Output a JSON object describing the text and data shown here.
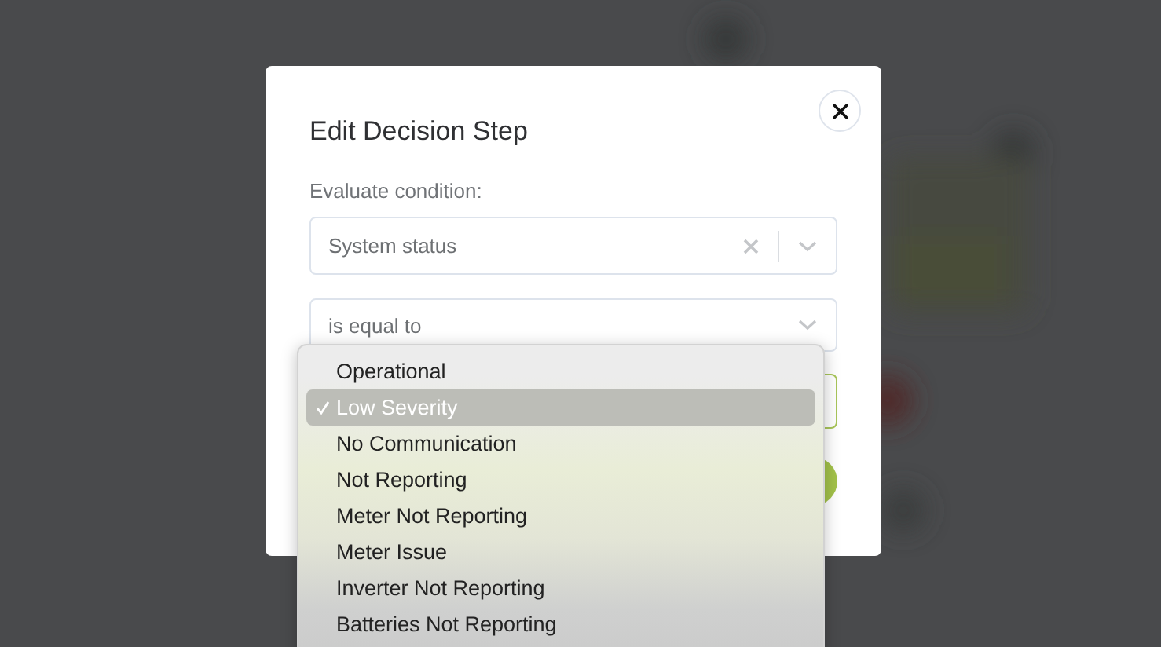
{
  "dialog": {
    "title": "Edit Decision Step",
    "condition_label": "Evaluate condition:",
    "condition_select": {
      "value": "System status",
      "clearable": true
    },
    "operator_select": {
      "value": "is equal to"
    }
  },
  "dropdown": {
    "options": [
      {
        "label": "Operational",
        "selected": false
      },
      {
        "label": "Low Severity",
        "selected": true
      },
      {
        "label": "No Communication",
        "selected": false
      },
      {
        "label": "Not Reporting",
        "selected": false
      },
      {
        "label": "Meter Not Reporting",
        "selected": false
      },
      {
        "label": "Meter Issue",
        "selected": false
      },
      {
        "label": "Inverter Not Reporting",
        "selected": false
      },
      {
        "label": "Batteries Not Reporting",
        "selected": false
      }
    ]
  }
}
